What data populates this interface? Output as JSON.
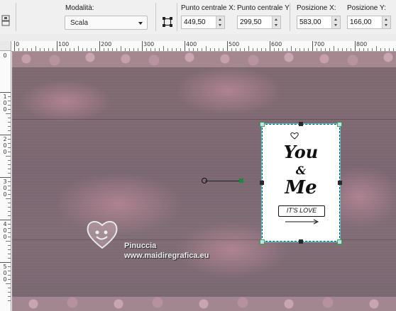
{
  "toolbar": {
    "mode_label": "Modalità:",
    "mode_value": "Scala",
    "pivot_x_label": "Punto centrale X:",
    "pivot_x_value": "449,50",
    "pivot_y_label": "Punto centrale Y:",
    "pivot_y_value": "299,50",
    "pos_x_label": "Posizione X:",
    "pos_x_value": "583,00",
    "pos_y_label": "Posizione Y:",
    "pos_y_value": "166,00"
  },
  "ruler_top": [
    "0",
    "100",
    "200",
    "300",
    "400",
    "500",
    "600",
    "700",
    "800",
    "900"
  ],
  "ruler_left": [
    [
      "1",
      "0",
      "0"
    ],
    [
      "2",
      "0",
      "0"
    ],
    [
      "3",
      "0",
      "0"
    ],
    [
      "4",
      "0",
      "0"
    ],
    [
      "5",
      "0",
      "0"
    ]
  ],
  "card": {
    "line1": "You",
    "line2": "&",
    "line3": "Me",
    "banner": "IT'S LOVE"
  },
  "watermark": {
    "name": "Pinuccia",
    "url": "www.maidiregrafica.eu"
  },
  "colors": {
    "canvas_base": "#7c6870",
    "band": "#a5878f",
    "selection": "#38d4e0"
  },
  "icons": [
    "layer-icon",
    "pick-mode-icon",
    "heart-logo-icon"
  ]
}
